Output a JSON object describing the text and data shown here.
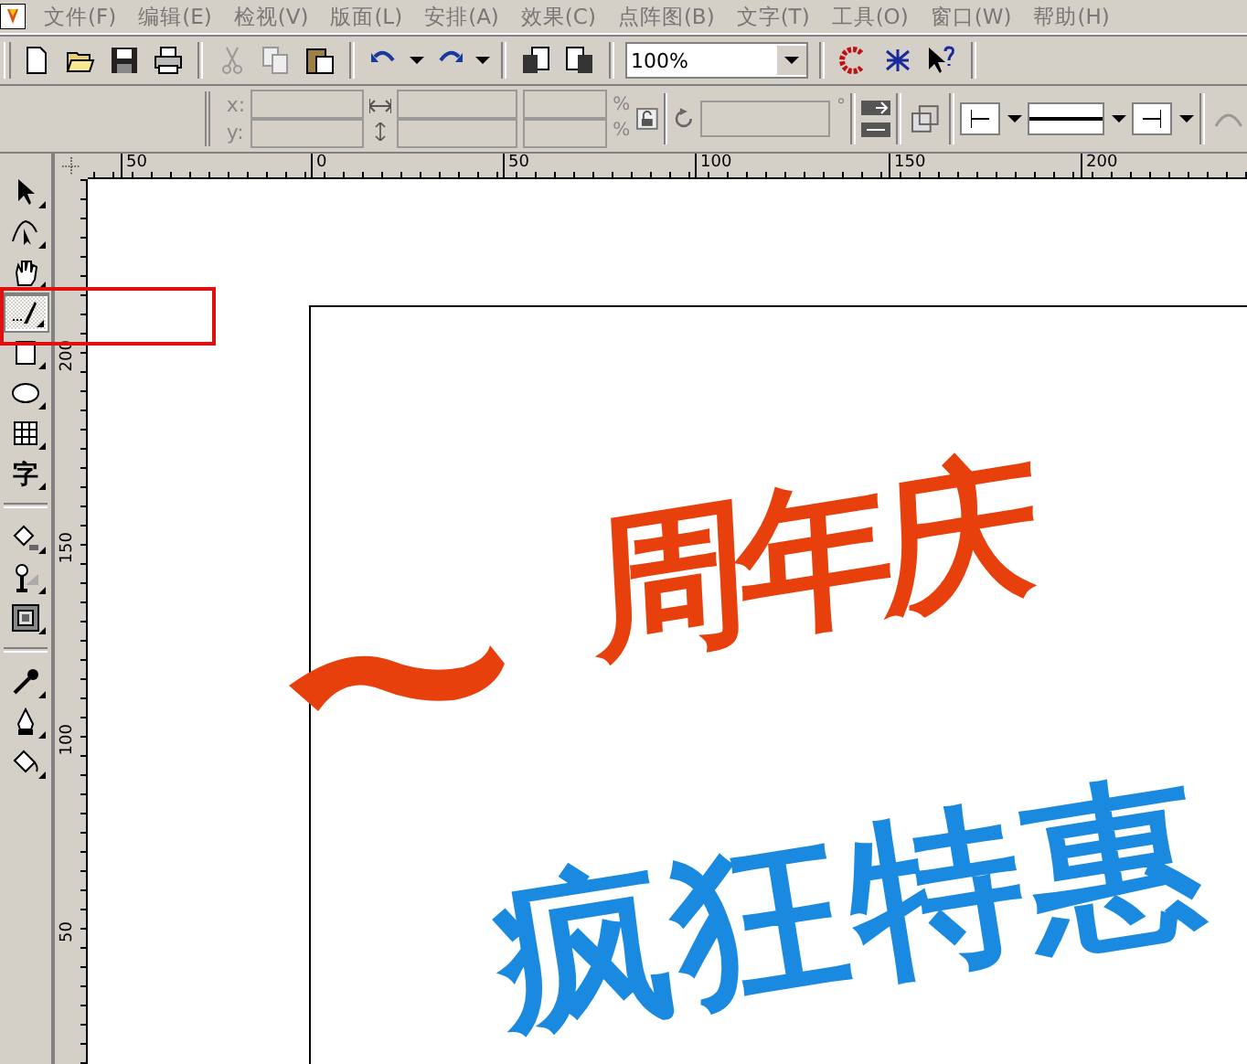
{
  "menu_bar": {
    "items": [
      "文件(F)",
      "编辑(E)",
      "检视(V)",
      "版面(L)",
      "安排(A)",
      "效果(C)",
      "点阵图(B)",
      "文字(T)",
      "工具(O)",
      "窗口(W)",
      "帮助(H)"
    ]
  },
  "standard_toolbar": {
    "zoom_level": "100%"
  },
  "property_bar": {
    "x_label": "x:",
    "y_label": "y:",
    "scale_unit_top": "%",
    "scale_unit_bottom": "%",
    "angle_unit": "°"
  },
  "horizontal_ruler": {
    "labels": [
      "50",
      "0",
      "50",
      "100",
      "150",
      "200"
    ]
  },
  "vertical_ruler": {
    "labels": [
      "200",
      "150",
      "100",
      "50"
    ]
  },
  "toolbox": {
    "groups": [
      [
        {
          "kind": "pick",
          "selected": false
        },
        {
          "kind": "shape",
          "selected": false
        },
        {
          "kind": "zoom",
          "selected": false
        },
        {
          "kind": "freehand",
          "selected": true
        },
        {
          "kind": "rectangle",
          "selected": false
        },
        {
          "kind": "ellipse",
          "selected": false
        },
        {
          "kind": "table",
          "selected": false
        },
        {
          "kind": "text",
          "label": "字",
          "selected": false
        }
      ],
      [
        {
          "kind": "fill",
          "selected": false
        },
        {
          "kind": "blend",
          "selected": false
        },
        {
          "kind": "contour",
          "selected": false
        }
      ],
      [
        {
          "kind": "eyedropper",
          "selected": false
        },
        {
          "kind": "pen",
          "selected": false
        },
        {
          "kind": "bucket",
          "selected": false
        }
      ]
    ]
  },
  "canvas": {
    "title_text": "周年庆",
    "subtitle_text": "疯狂特惠"
  }
}
